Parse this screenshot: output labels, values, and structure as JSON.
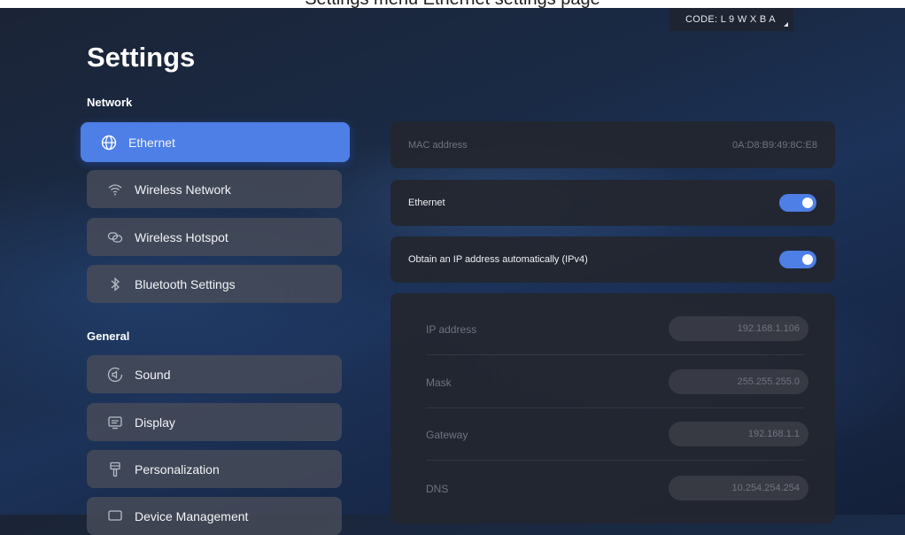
{
  "top_strip_text": "Settings menu Ethernet settings page",
  "code_label": "CODE: L 9 W X B A",
  "page_title": "Settings",
  "sections": {
    "network": "Network",
    "general": "General"
  },
  "nav": {
    "ethernet": {
      "label": "Ethernet",
      "icon": "globe-icon"
    },
    "wireless_network": {
      "label": "Wireless Network",
      "icon": "wifi-icon"
    },
    "wireless_hotspot": {
      "label": "Wireless Hotspot",
      "icon": "hotspot-icon"
    },
    "bluetooth": {
      "label": "Bluetooth Settings",
      "icon": "bluetooth-icon"
    },
    "sound": {
      "label": "Sound",
      "icon": "sound-icon"
    },
    "display": {
      "label": "Display",
      "icon": "display-icon"
    },
    "personalization": {
      "label": "Personalization",
      "icon": "brush-icon"
    },
    "device_management": {
      "label": "Device Management",
      "icon": "device-icon"
    }
  },
  "detail": {
    "mac_label": "MAC address",
    "mac_value": "0A:D8:B9:49:8C:E8",
    "ethernet_label": "Ethernet",
    "ethernet_on": true,
    "dhcp_label": "Obtain an IP address automatically (IPv4)",
    "dhcp_on": true,
    "ip_rows": [
      {
        "label": "IP address",
        "value": "192.168.1.106"
      },
      {
        "label": "Mask",
        "value": "255.255.255.0"
      },
      {
        "label": "Gateway",
        "value": "192.168.1.1"
      },
      {
        "label": "DNS",
        "value": "10.254.254.254"
      }
    ]
  },
  "colors": {
    "accent": "#4e7fe6",
    "card": "#23262f",
    "nav_item": "#484c58",
    "muted_text": "#6f7482"
  }
}
